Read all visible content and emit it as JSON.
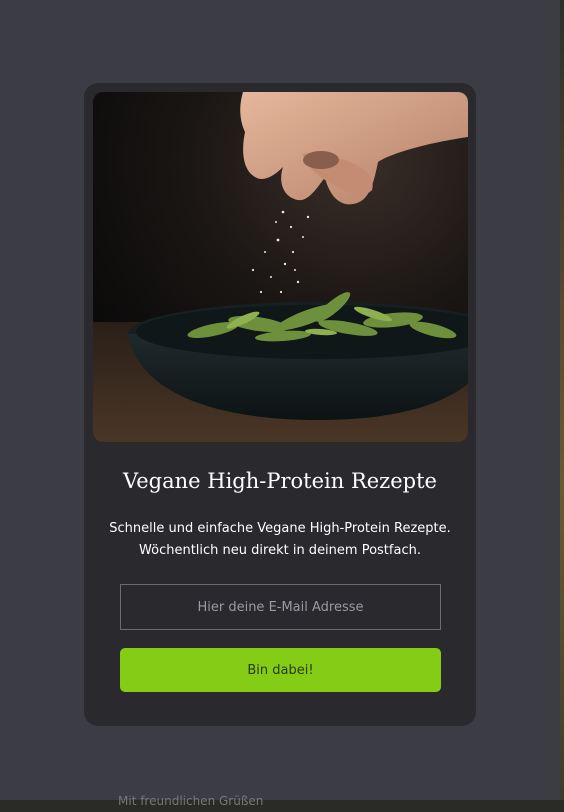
{
  "page": {
    "background_color": "#3c3c45",
    "bottom_peek_text": "Mit freundlichen Grüßen"
  },
  "modal": {
    "background_color": "#29292e",
    "image_alt": "Hand streut Salz über Edamame in einer dunklen Schüssel",
    "title": "Vegane High-Protein Rezepte",
    "description_line1": "Schnelle und einfache Vegane High-Protein Rezepte.",
    "description_line2": "Wöchentlich neu direkt in deinem Postfach.",
    "email_placeholder": "Hier deine E-Mail Adresse",
    "submit_label": "Bin dabei!",
    "accent_color": "#84cc16"
  }
}
